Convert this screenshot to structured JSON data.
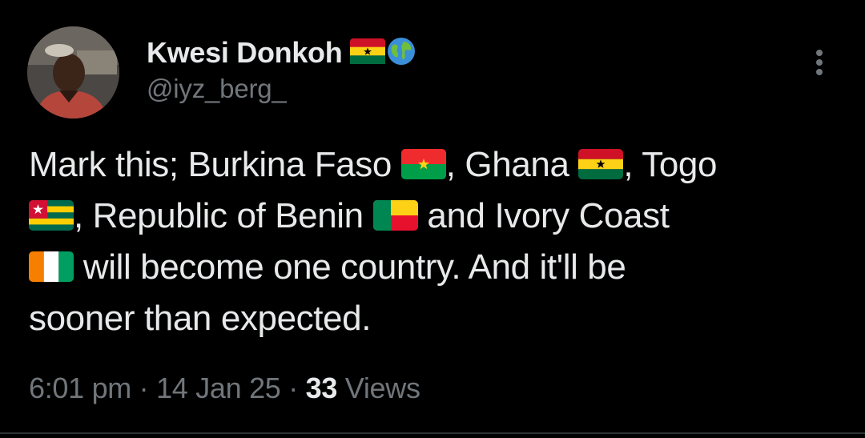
{
  "tweet": {
    "author": {
      "display_name": "Kwesi Donkoh",
      "name_emojis": [
        "ghana-flag-emoji",
        "globe-emoji"
      ],
      "handle": "@iyz_berg_"
    },
    "text_lines": [
      {
        "before": "Mark this; Burkina Faso ",
        "flag1": "burkina-faso-flag",
        "middle": ", Ghana ",
        "flag2": "ghana-flag",
        "after": ", Togo"
      },
      {
        "flag0": "togo-flag",
        "before": ", Republic of Benin ",
        "flag1": "benin-flag",
        "after": " and Ivory Coast"
      },
      {
        "flag0": "ivory-coast-flag",
        "after": " will become one country. And it'll be"
      },
      {
        "after": "sooner than expected."
      }
    ],
    "meta": {
      "time": "6:01 pm",
      "separator": " · ",
      "date": "14 Jan 25",
      "views_count": "33",
      "views_label": " Views"
    }
  },
  "colors": {
    "background": "#000000",
    "text_primary": "#e7e9ea",
    "text_secondary": "#71767b",
    "divider": "#2f3336"
  }
}
